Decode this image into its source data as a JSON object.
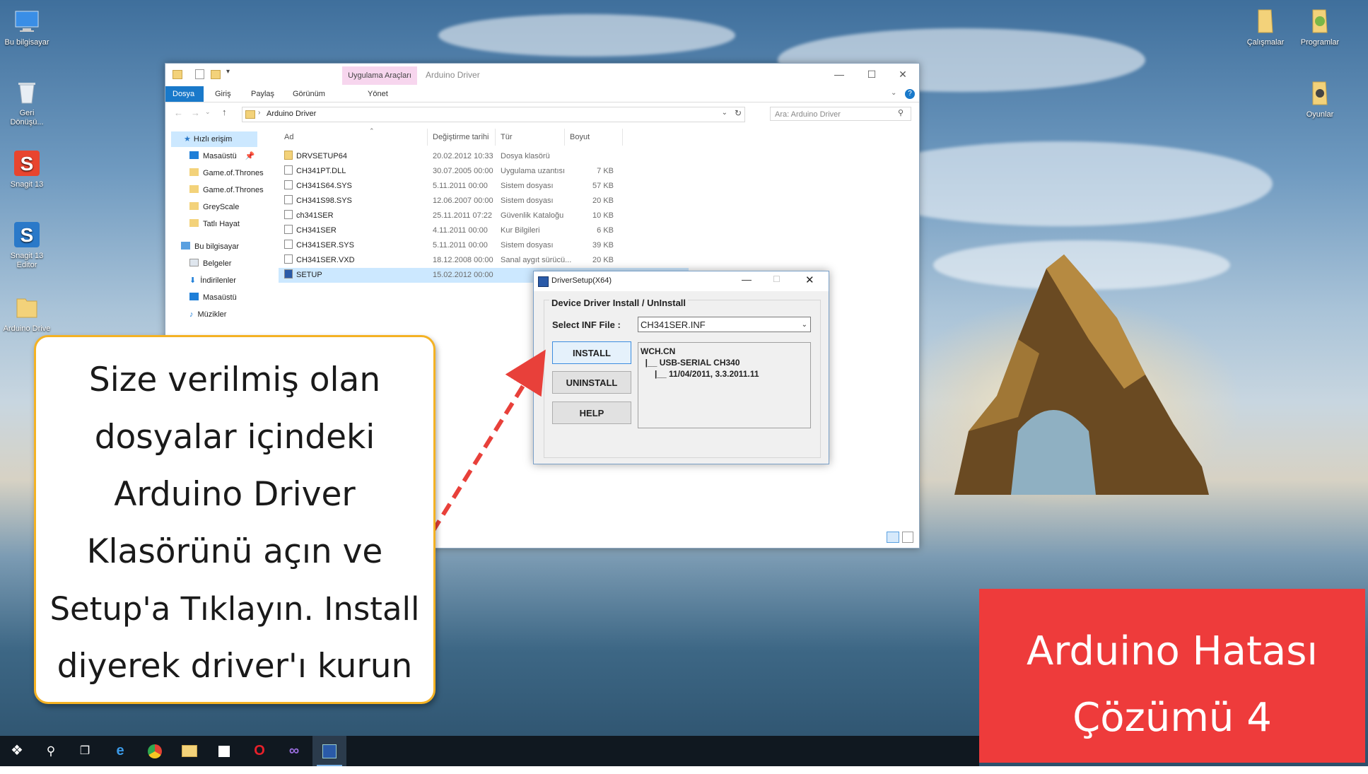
{
  "desktop": {
    "left_icons": [
      {
        "label": "Bu bilgisayar"
      },
      {
        "label": "Geri Dönüşü..."
      },
      {
        "label": "Snagit 13"
      },
      {
        "label": "Snagit 13 Editor"
      },
      {
        "label": "Arduino Drive"
      }
    ],
    "right_icons": [
      {
        "label": "Çalışmalar"
      },
      {
        "label": "Programlar"
      },
      {
        "label": "Oyunlar"
      }
    ]
  },
  "explorer": {
    "context_tab": "Uygulama Araçları",
    "window_title": "Arduino Driver",
    "ribbon_tabs": [
      "Dosya",
      "Giriş",
      "Paylaş",
      "Görünüm",
      "Yönet"
    ],
    "address_path": "Arduino Driver",
    "search_placeholder": "Ara: Arduino Driver",
    "nav": [
      "Hızlı erişim",
      "Masaüstü",
      "Game.of.Thrones",
      "Game.of.Thrones",
      "GreyScale",
      "Tatlı Hayat",
      "Bu bilgisayar",
      "Belgeler",
      "İndirilenler",
      "Masaüstü",
      "Müzikler"
    ],
    "columns": [
      "Ad",
      "Değiştirme tarihi",
      "Tür",
      "Boyut"
    ],
    "files": [
      {
        "name": "DRVSETUP64",
        "date": "20.02.2012 10:33",
        "type": "Dosya klasörü",
        "size": ""
      },
      {
        "name": "CH341PT.DLL",
        "date": "30.07.2005 00:00",
        "type": "Uygulama uzantısı",
        "size": "7 KB"
      },
      {
        "name": "CH341S64.SYS",
        "date": "5.11.2011 00:00",
        "type": "Sistem dosyası",
        "size": "57 KB"
      },
      {
        "name": "CH341S98.SYS",
        "date": "12.06.2007 00:00",
        "type": "Sistem dosyası",
        "size": "20 KB"
      },
      {
        "name": "ch341SER",
        "date": "25.11.2011 07:22",
        "type": "Güvenlik Kataloğu",
        "size": "10 KB"
      },
      {
        "name": "CH341SER",
        "date": "4.11.2011 00:00",
        "type": "Kur Bilgileri",
        "size": "6 KB"
      },
      {
        "name": "CH341SER.SYS",
        "date": "5.11.2011 00:00",
        "type": "Sistem dosyası",
        "size": "39 KB"
      },
      {
        "name": "CH341SER.VXD",
        "date": "18.12.2008 00:00",
        "type": "Sanal aygıt sürücü...",
        "size": "20 KB"
      },
      {
        "name": "SETUP",
        "date": "15.02.2012 00:00",
        "type": "",
        "size": ""
      }
    ]
  },
  "dialog": {
    "title": "DriverSetup(X64)",
    "group_label": "Device Driver Install / UnInstall",
    "inf_label": "Select INF File :",
    "inf_value": "CH341SER.INF",
    "buttons": {
      "install": "INSTALL",
      "uninstall": "UNINSTALL",
      "help": "HELP"
    },
    "tree_lines": [
      "WCH.CN",
      "  |__ USB-SERIAL CH340",
      "      |__ 11/04/2011, 3.3.2011.11"
    ]
  },
  "callout": {
    "lines": [
      "Size verilmiş olan",
      "dosyalar içindeki",
      "Arduino Driver",
      "Klasörünü açın ve",
      "Setup'a Tıklayın. Install",
      "diyerek driver'ı kurun"
    ]
  },
  "badge": {
    "line1": "Arduino Hatası",
    "line2": "Çözümü 4"
  },
  "taskbar": {
    "icons": [
      "windows-start-icon",
      "search-icon",
      "task-view-icon",
      "edge-icon",
      "chrome-icon",
      "file-explorer-icon",
      "store-icon",
      "opera-icon",
      "visual-studio-icon",
      "driver-setup-icon"
    ]
  },
  "colors": {
    "callout_border": "#f4b224",
    "badge_bg": "#ee3b3b",
    "ribbon_active": "#1979ca",
    "context_tab": "#f7d6ee",
    "arrow": "#e8403a"
  }
}
